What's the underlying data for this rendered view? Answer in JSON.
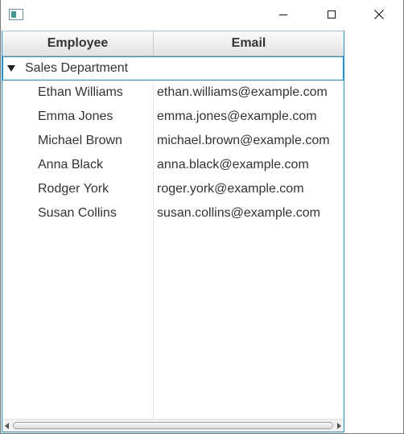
{
  "window": {
    "icon": "app-window-icon",
    "controls": {
      "minimize": "minimize-icon",
      "maximize": "maximize-icon",
      "close": "close-icon"
    }
  },
  "table": {
    "columns": [
      "Employee",
      "Email"
    ],
    "group": {
      "label": "Sales Department",
      "expanded": true
    },
    "rows": [
      {
        "name": "Ethan Williams",
        "email": "ethan.williams@example.com"
      },
      {
        "name": "Emma Jones",
        "email": "emma.jones@example.com"
      },
      {
        "name": "Michael Brown",
        "email": "michael.brown@example.com"
      },
      {
        "name": "Anna Black",
        "email": "anna.black@example.com"
      },
      {
        "name": "Rodger York",
        "email": "roger.york@example.com"
      },
      {
        "name": "Susan Collins",
        "email": "susan.collins@example.com"
      }
    ]
  },
  "colors": {
    "selection_border": "#1e90d6",
    "header_bg": "#e8e8e8",
    "text": "#333333"
  }
}
